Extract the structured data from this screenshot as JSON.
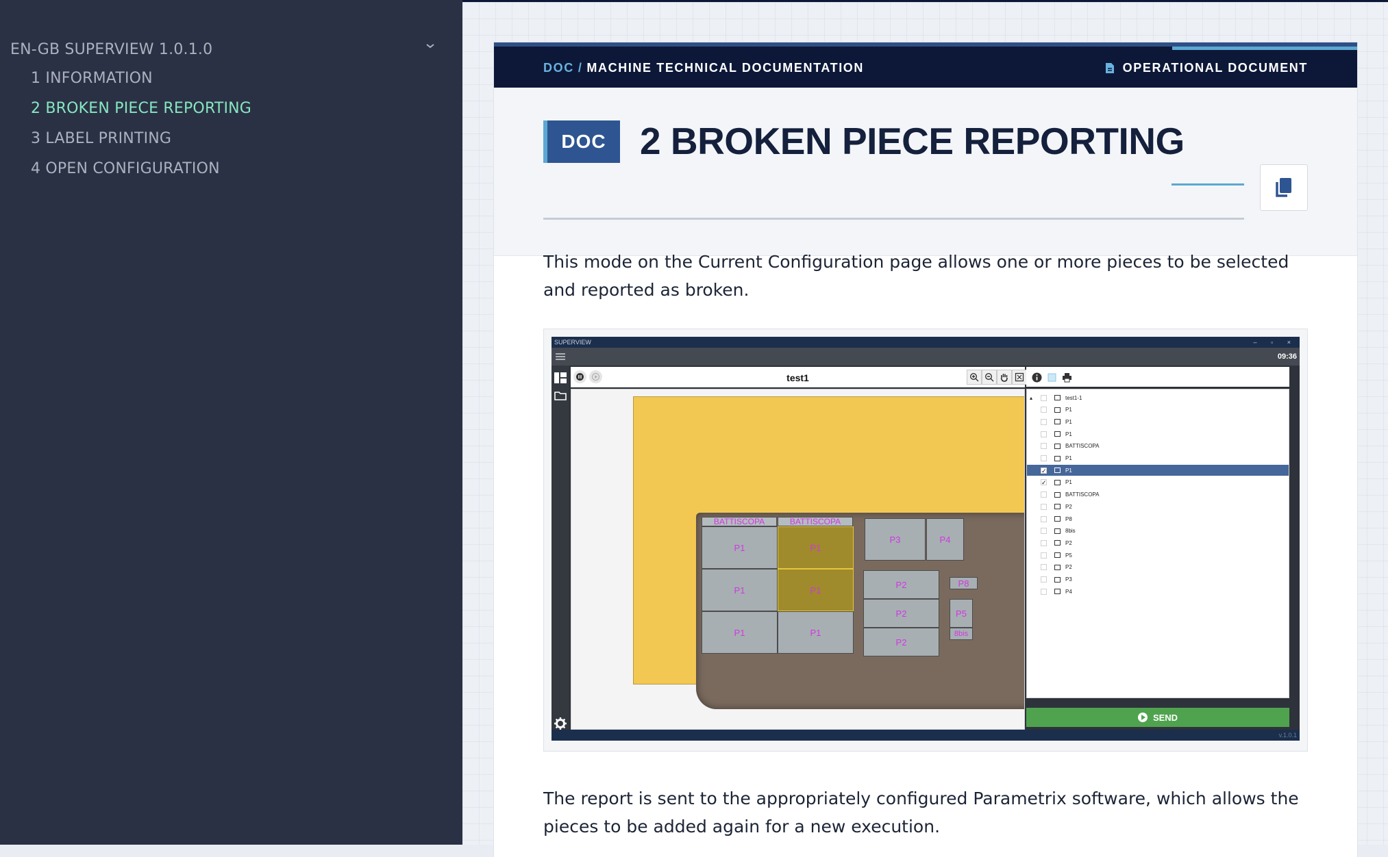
{
  "sidebar": {
    "title": "EN-GB SUPERVIEW 1.0.1.0",
    "items": [
      {
        "label": "1 INFORMATION",
        "active": false
      },
      {
        "label": "2 BROKEN PIECE REPORTING",
        "active": true
      },
      {
        "label": "3 LABEL PRINTING",
        "active": false
      },
      {
        "label": "4 OPEN CONFIGURATION",
        "active": false
      }
    ]
  },
  "topbar": {
    "crumb_root": "DOC",
    "crumb_separator": "/",
    "crumb_section": "MACHINE TECHNICAL DOCUMENTATION",
    "doc_type": "OPERATIONAL DOCUMENT"
  },
  "header": {
    "badge": "DOC",
    "title": "2 BROKEN PIECE REPORTING"
  },
  "content": {
    "intro": "This mode on the Current Configuration page allows one or more pieces to be selected and reported as broken.",
    "outro": "The report is sent to the appropriately configured Parametrix software, which allows the pieces to be added again for a new execution."
  },
  "screenshot": {
    "app_title": "SUPERVIEW",
    "window_controls": "– ▫ ×",
    "clock": "09:36",
    "canvas_title": "test1",
    "pieces": [
      {
        "label": "BATTISCOPA"
      },
      {
        "label": "BATTISCOPA"
      },
      {
        "label": "P1"
      },
      {
        "label": "P1"
      },
      {
        "label": "P1"
      },
      {
        "label": "P1"
      },
      {
        "label": "P1"
      },
      {
        "label": "P1"
      },
      {
        "label": "P3"
      },
      {
        "label": "P4"
      },
      {
        "label": "P2"
      },
      {
        "label": "P2"
      },
      {
        "label": "P2"
      },
      {
        "label": "P8"
      },
      {
        "label": "P5"
      },
      {
        "label": "8bis"
      }
    ],
    "tree": [
      {
        "label": "test1-1",
        "checked": false,
        "selected": false
      },
      {
        "label": "P1",
        "checked": false,
        "selected": false
      },
      {
        "label": "P1",
        "checked": false,
        "selected": false
      },
      {
        "label": "P1",
        "checked": false,
        "selected": false
      },
      {
        "label": "BATTISCOPA",
        "checked": false,
        "selected": false
      },
      {
        "label": "P1",
        "checked": false,
        "selected": false
      },
      {
        "label": "P1",
        "checked": true,
        "selected": true
      },
      {
        "label": "P1",
        "checked": true,
        "selected": false
      },
      {
        "label": "BATTISCOPA",
        "checked": false,
        "selected": false
      },
      {
        "label": "P2",
        "checked": false,
        "selected": false
      },
      {
        "label": "P8",
        "checked": false,
        "selected": false
      },
      {
        "label": "8bis",
        "checked": false,
        "selected": false
      },
      {
        "label": "P2",
        "checked": false,
        "selected": false
      },
      {
        "label": "P5",
        "checked": false,
        "selected": false
      },
      {
        "label": "P2",
        "checked": false,
        "selected": false
      },
      {
        "label": "P3",
        "checked": false,
        "selected": false
      },
      {
        "label": "P4",
        "checked": false,
        "selected": false
      }
    ],
    "send_label": "SEND",
    "version": "v.1.0.1"
  },
  "colors": {
    "sidebar_bg": "#2b3144",
    "sidebar_active": "#86e6c1",
    "topbar_bg": "#0d1838",
    "accent": "#5ca8d2",
    "badge_bg": "#2e5592",
    "send_green": "#4fa34f"
  },
  "icons": {
    "sidebar_toggle": "chevron-down-icon",
    "doc_type": "document-icon",
    "copy": "copy-icon"
  }
}
